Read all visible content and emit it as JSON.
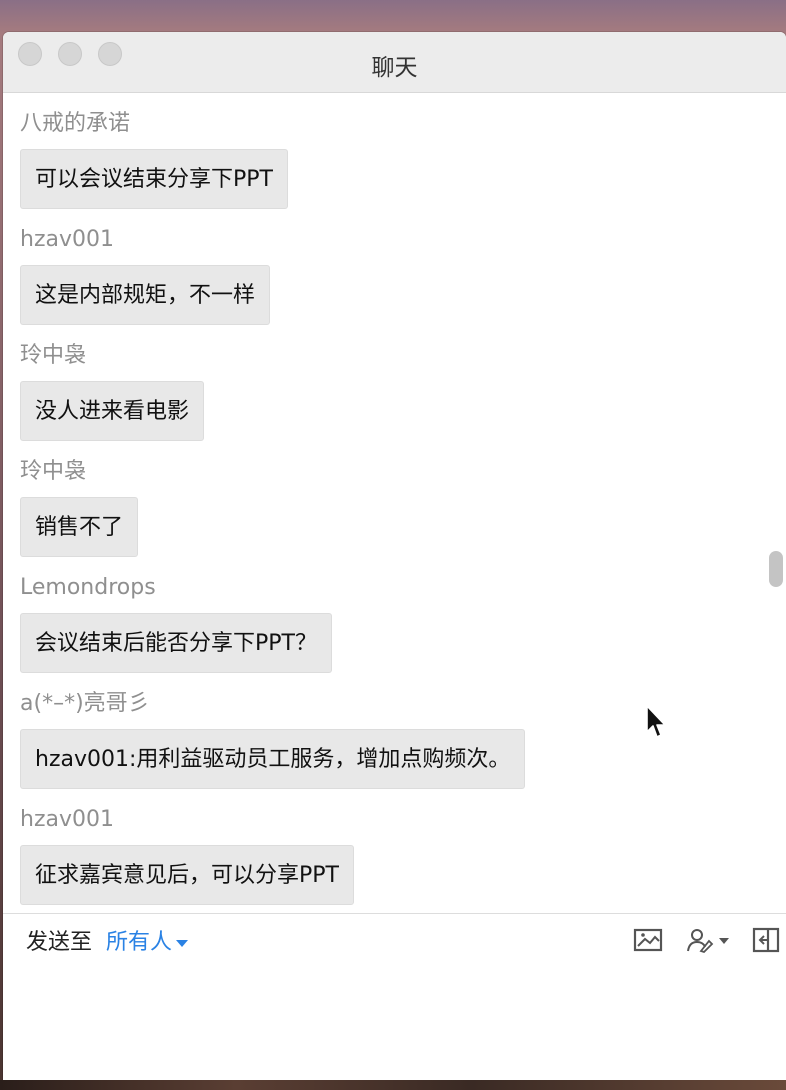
{
  "window": {
    "title": "聊天"
  },
  "messages": [
    {
      "sender": "八戒的承诺",
      "text": "可以会议结束分享下PPT"
    },
    {
      "sender": "hzav001",
      "text": "这是内部规矩，不一样"
    },
    {
      "sender": "玲中袅",
      "text": "没人进来看电影"
    },
    {
      "sender": "玲中袅",
      "text": "销售不了"
    },
    {
      "sender": "Lemondrops",
      "text": "会议结束后能否分享下PPT？"
    },
    {
      "sender": "a(*–*)亮哥彡",
      "text": "hzav001:用利益驱动员工服务，增加点购频次。"
    },
    {
      "sender": "hzav001",
      "text": "征求嘉宾意见后，可以分享PPT"
    }
  ],
  "composer": {
    "send_to_label": "发送至",
    "recipient": "所有人",
    "toolbar_icons": [
      "image-icon",
      "signature-icon",
      "exit-icon"
    ]
  },
  "colors": {
    "accent": "#2a82e4",
    "bubble_bg": "#e8e8e8",
    "sender_text": "#8f8f8f"
  }
}
